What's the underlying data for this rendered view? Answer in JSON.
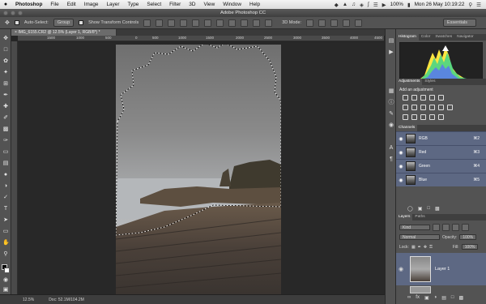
{
  "menubar": {
    "apple": "",
    "items": [
      "Photoshop",
      "File",
      "Edit",
      "Image",
      "Layer",
      "Type",
      "Select",
      "Filter",
      "3D",
      "View",
      "Window",
      "Help"
    ],
    "battery": "100%",
    "clock": "Mon 26 May  10:19:22"
  },
  "window": {
    "title": "Adobe Photoshop CC"
  },
  "options": {
    "auto_select_label": "Auto-Select:",
    "auto_select_value": "Group",
    "transform_label": "Show Transform Controls",
    "mode_3d": "3D Mode:",
    "workspace": "Essentials"
  },
  "document": {
    "tab": "IMG_6155.CR2 @ 12.5% (Layer 1, RGB/8*) *",
    "zoom": "12.5%",
    "doc_info": "Doc: 52.1M/104.2M"
  },
  "ruler_ticks": [
    "1500",
    "1000",
    "500",
    "0",
    "500",
    "1000",
    "1500",
    "2000",
    "2500",
    "3000",
    "3500",
    "4000",
    "4500"
  ],
  "panels": {
    "top_tabs": [
      "Histogram",
      "Color",
      "Swatches",
      "Navigator"
    ],
    "adj_tabs": [
      "Adjustments",
      "Styles"
    ],
    "adj_title": "Add an adjustment",
    "channels_tab": "Channels",
    "channels": [
      {
        "name": "RGB",
        "shortcut": "⌘2"
      },
      {
        "name": "Red",
        "shortcut": "⌘3"
      },
      {
        "name": "Green",
        "shortcut": "⌘4"
      },
      {
        "name": "Blue",
        "shortcut": "⌘5"
      }
    ],
    "layer_tabs": [
      "Layers",
      "Paths"
    ],
    "kind_label": "Kind",
    "blend_mode": "Normal",
    "opacity_label": "Opacity:",
    "opacity_value": "100%",
    "lock_label": "Lock:",
    "fill_label": "Fill:",
    "fill_value": "100%",
    "layer_name": "Layer 1"
  }
}
